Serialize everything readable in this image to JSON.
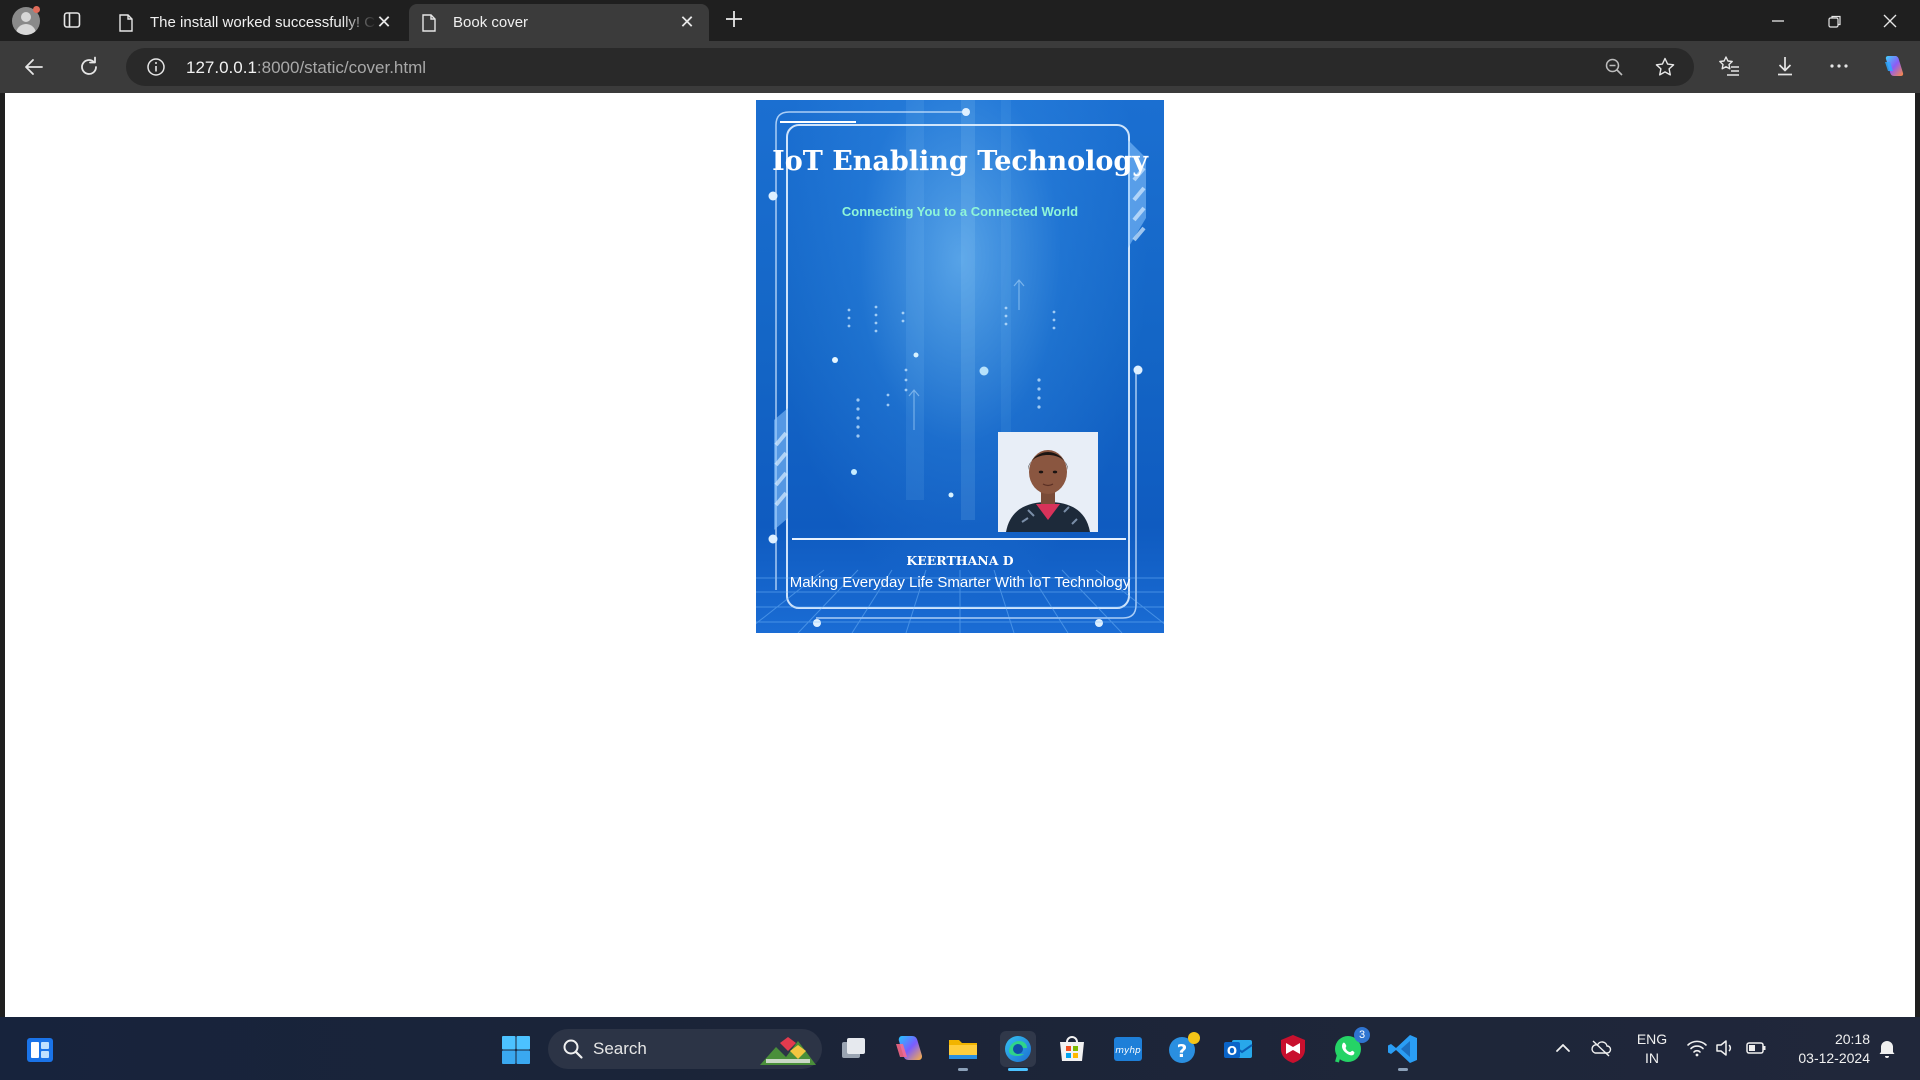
{
  "browser": {
    "tabs": [
      {
        "label": "The install worked successfully! Congratulations!",
        "active": false
      },
      {
        "label": "Book cover",
        "active": true
      }
    ],
    "url_host": "127.0.0.1",
    "url_rest": ":8000/static/cover.html"
  },
  "cover": {
    "title": "IoT Enabling Technology",
    "subtitle": "Connecting You to a Connected World",
    "author": "KEERTHANA D",
    "tagline": "Making Everyday Life Smarter With IoT Technology"
  },
  "taskbar": {
    "search_label": "Search",
    "whatsapp_badge": "3",
    "lang_line1": "ENG",
    "lang_line2": "IN",
    "time": "20:18",
    "date": "03-12-2024"
  },
  "colors": {
    "cover_blue": "#1466c6",
    "subtitle_accent": "#8ff5d8",
    "active_indicator": "#4cc2ff"
  }
}
